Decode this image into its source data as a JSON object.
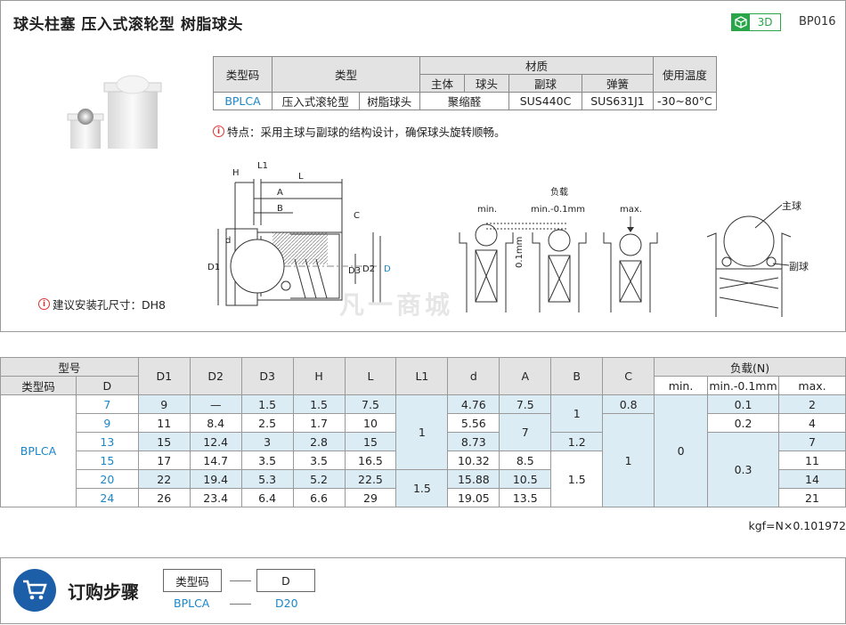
{
  "header": {
    "title": "球头柱塞  压入式滚轮型  树脂球头",
    "badge_3d": "3D",
    "code": "BP016"
  },
  "spec": {
    "h_type_code": "类型码",
    "h_type": "类型",
    "h_material": "材质",
    "h_temp": "使用温度",
    "h_body": "主体",
    "h_ball": "球头",
    "h_sub_ball": "副球",
    "h_spring": "弹簧",
    "type_code": "BPLCA",
    "type1": "压入式滚轮型",
    "type2": "树脂球头",
    "body_ball": "聚缩醛",
    "sub_ball": "SUS440C",
    "spring": "SUS631J1",
    "temp": "-30~80°C"
  },
  "notes": {
    "feature": "特点：采用主球与副球的结构设计，确保球头旋转顺畅。",
    "install": "建议安装孔尺寸：DH8"
  },
  "drawing": {
    "H": "H",
    "L1": "L1",
    "L": "L",
    "A": "A",
    "B": "B",
    "C": "C",
    "d": "d",
    "D1": "D1",
    "D2": "D2",
    "D3": "D3",
    "D": "D",
    "load_label": "负载",
    "min": "min.",
    "min01": "min.-0.1mm",
    "max": "max.",
    "gap": "0.1mm",
    "main_ball": "主球",
    "sub_ball": "副球",
    "watermark": "凡一商城"
  },
  "dims": {
    "h_model": "型号",
    "h_type_code": "类型码",
    "h_D": "D",
    "cols": [
      "D1",
      "D2",
      "D3",
      "H",
      "L",
      "L1",
      "d",
      "A",
      "B",
      "C"
    ],
    "h_load": "负载(N)",
    "load_cols": [
      "min.",
      "min.-0.1mm",
      "max."
    ],
    "type_code": "BPLCA",
    "rows": [
      {
        "D": "7",
        "D1": "9",
        "D2": "—",
        "D3": "1.5",
        "H": "1.5",
        "L": "7.5",
        "d": "4.76",
        "A": "7.5",
        "C": "0.8",
        "mid": "0.1",
        "max": "2"
      },
      {
        "D": "9",
        "D1": "11",
        "D2": "8.4",
        "D3": "2.5",
        "H": "1.7",
        "L": "10",
        "d": "5.56",
        "max": "4",
        "mid": "0.2"
      },
      {
        "D": "13",
        "D1": "15",
        "D2": "12.4",
        "D3": "3",
        "H": "2.8",
        "L": "15",
        "d": "8.73",
        "B": "1.2",
        "max": "7"
      },
      {
        "D": "15",
        "D1": "17",
        "D2": "14.7",
        "D3": "3.5",
        "H": "3.5",
        "L": "16.5",
        "d": "10.32",
        "A": "8.5",
        "max": "11"
      },
      {
        "D": "20",
        "D1": "22",
        "D2": "19.4",
        "D3": "5.3",
        "H": "5.2",
        "L": "22.5",
        "d": "15.88",
        "A": "10.5",
        "max": "14"
      },
      {
        "D": "24",
        "D1": "26",
        "D2": "23.4",
        "D3": "6.4",
        "H": "6.6",
        "L": "29",
        "d": "19.05",
        "A": "13.5",
        "max": "21"
      }
    ],
    "merged": {
      "L1_a": "1",
      "L1_b": "1.5",
      "A_b": "7",
      "B_a": "1",
      "B_b": "1.5",
      "C_b": "1",
      "min_all": "0",
      "mid_c": "0.3"
    }
  },
  "kgf": "kgf=N×0.101972",
  "order": {
    "title": "订购步骤",
    "box1": "类型码",
    "box2": "D",
    "val1": "BPLCA",
    "val2": "D20"
  }
}
